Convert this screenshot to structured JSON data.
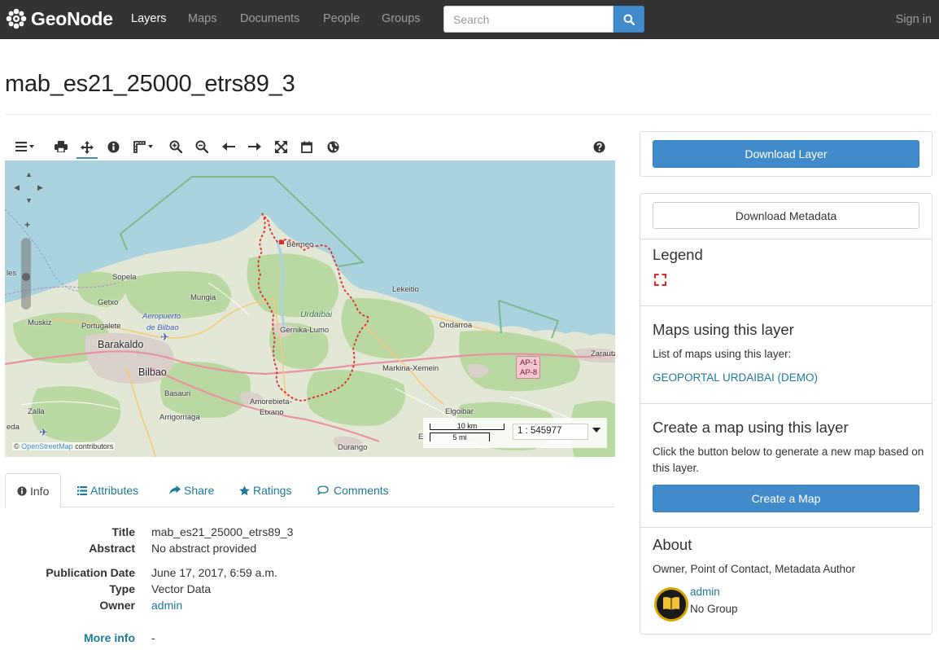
{
  "navbar": {
    "brand": "GeoNode",
    "items": [
      "Layers",
      "Maps",
      "Documents",
      "People",
      "Groups"
    ],
    "active_item": "Layers",
    "search_placeholder": "Search",
    "signin": "Sign in"
  },
  "page": {
    "title": "mab_es21_25000_etrs89_3"
  },
  "map": {
    "labels": {
      "bermeo": "Bermeo",
      "sopela": "Sopela",
      "getxo": "Getxo",
      "mungia": "Mungia",
      "lekeitio": "Lekeitio",
      "airport1": "Aeropuerto",
      "airport2": "de Bilbao",
      "muskiz": "Muskiz",
      "portugalete": "Portugalete",
      "urdaibai": "Urdaibai",
      "gernika": "Gernika-Lumo",
      "ondarroa": "Ondarroa",
      "barakaldo": "Barakaldo",
      "bilbao": "Bilbao",
      "basauri": "Basauri",
      "markina": "Markina-Xemein",
      "zarautz": "Zarautz",
      "amorebieta": "Amorebieta-",
      "etxano": "Etxano",
      "arrigorriaga": "Arrigorriaga",
      "elgoibar": "Elgoibar",
      "zalla": "Zalla",
      "durango": "Durango",
      "eda": "eda",
      "les": "les",
      "ei": "Ei",
      "road1": "AP-1",
      "road2": "AP-8"
    },
    "attribution_prefix": "©",
    "attribution_link": "OpenStreetMap",
    "attribution_suffix": "contributors",
    "scale_top": "10 km",
    "scale_bottom": "5 mi",
    "scale_value": "1 : 545977"
  },
  "tabs": [
    {
      "label": "Info",
      "icon": "info-circle-icon"
    },
    {
      "label": "Attributes",
      "icon": "list-icon"
    },
    {
      "label": "Share",
      "icon": "share-icon"
    },
    {
      "label": "Ratings",
      "icon": "star-icon"
    },
    {
      "label": "Comments",
      "icon": "comment-icon"
    }
  ],
  "info": {
    "title_label": "Title",
    "title_value": "mab_es21_25000_etrs89_3",
    "abstract_label": "Abstract",
    "abstract_value": "No abstract provided",
    "pubdate_label": "Publication Date",
    "pubdate_value": "June 17, 2017, 6:59 a.m.",
    "type_label": "Type",
    "type_value": "Vector Data",
    "owner_label": "Owner",
    "owner_value": "admin",
    "more_label": "More info",
    "more_value": "-"
  },
  "sidebar": {
    "download_layer": "Download Layer",
    "download_metadata": "Download Metadata",
    "legend_title": "Legend",
    "maps_title": "Maps using this layer",
    "maps_text": "List of maps using this layer:",
    "maps_link": "GEOPORTAL URDAIBAI (DEMO)",
    "create_title": "Create a map using this layer",
    "create_text": "Click the button below to generate a new map based on this layer.",
    "create_button": "Create a Map",
    "about_title": "About",
    "about_text": "Owner, Point of Contact, Metadata Author",
    "owner_name": "admin",
    "owner_group": "No Group"
  },
  "colors": {
    "navbar_bg": "#333333",
    "primary": "#428bca",
    "link": "#1e7a9a",
    "legend_stroke": "#e0282a"
  }
}
